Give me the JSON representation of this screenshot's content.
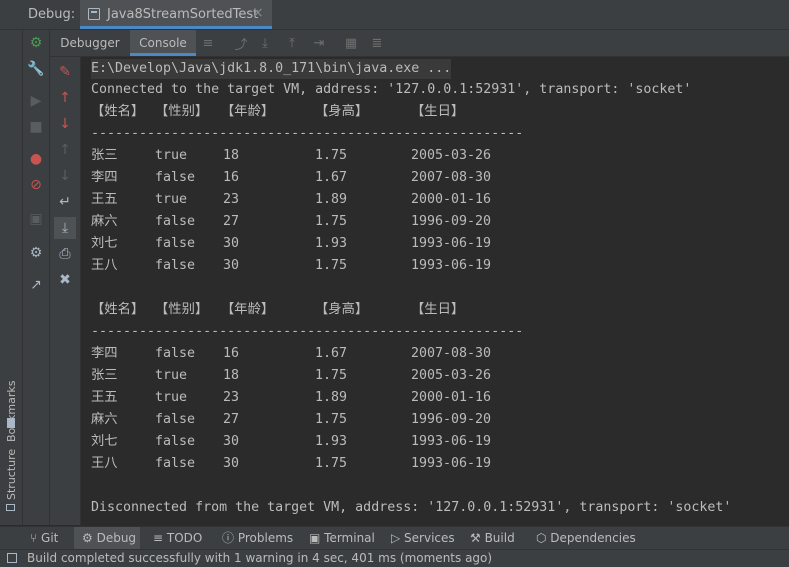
{
  "top": {
    "label": "Debug:",
    "session": "Java8StreamSortedTest",
    "close": "×"
  },
  "side": {
    "bookmarks": "Bookmarks",
    "structure": "Structure"
  },
  "tabs": {
    "debugger": "Debugger",
    "console": "Console"
  },
  "console": {
    "cmd": "E:\\Develop\\Java\\jdk1.8.0_171\\bin\\java.exe ...",
    "connected": "Connected to the target VM, address: '127.0.0.1:52931', transport: 'socket'",
    "headers": [
      "【姓名】",
      "【性别】",
      "【年龄】",
      "【身高】",
      "【生日】"
    ],
    "divider": "------------------------------------------------------",
    "table1": [
      [
        "张三",
        "true",
        "18",
        "1.75",
        "2005-03-26"
      ],
      [
        "李四",
        "false",
        "16",
        "1.67",
        "2007-08-30"
      ],
      [
        "王五",
        "true",
        "23",
        "1.89",
        "2000-01-16"
      ],
      [
        "麻六",
        "false",
        "27",
        "1.75",
        "1996-09-20"
      ],
      [
        "刘七",
        "false",
        "30",
        "1.93",
        "1993-06-19"
      ],
      [
        "王八",
        "false",
        "30",
        "1.75",
        "1993-06-19"
      ]
    ],
    "table2": [
      [
        "李四",
        "false",
        "16",
        "1.67",
        "2007-08-30"
      ],
      [
        "张三",
        "true",
        "18",
        "1.75",
        "2005-03-26"
      ],
      [
        "王五",
        "true",
        "23",
        "1.89",
        "2000-01-16"
      ],
      [
        "麻六",
        "false",
        "27",
        "1.75",
        "1996-09-20"
      ],
      [
        "刘七",
        "false",
        "30",
        "1.93",
        "1993-06-19"
      ],
      [
        "王八",
        "false",
        "30",
        "1.75",
        "1993-06-19"
      ]
    ],
    "disconnected": "Disconnected from the target VM, address: '127.0.0.1:52931', transport: 'socket'"
  },
  "bottom": {
    "git": "Git",
    "debug": "Debug",
    "todo": "TODO",
    "problems": "Problems",
    "terminal": "Terminal",
    "services": "Services",
    "build": "Build",
    "dependencies": "Dependencies"
  },
  "status": "Build completed successfully with 1 warning in 4 sec, 401 ms (moments ago)",
  "colors": {
    "accent": "#4a88c7",
    "background": "#2b2b2b",
    "panel": "#3c3f41",
    "bug": "#499c54",
    "stop_red": "#c75450"
  }
}
